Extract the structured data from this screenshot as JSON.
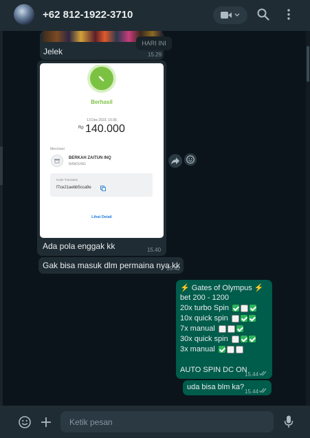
{
  "header": {
    "contact": "+62 812-1922-3710"
  },
  "chat": {
    "messages": {
      "m1": {
        "text": "Jelek",
        "time": "15.29"
      },
      "date_badge": "HARI INI",
      "receipt": {
        "status": "Berhasil",
        "date": "13 Des 2023, 15:36",
        "currency": "Rp",
        "amount": "140.000",
        "merchant_label": "Merchant",
        "merchant_name": "BERKAH ZAITUN INQ",
        "merchant_city": "BANDUNG",
        "trx_label": "Kode Transaksi",
        "trx_id": "f7ce21aebb5cca9e",
        "detail_link": "Lihat Detail"
      },
      "m2": {
        "text": "Ada pola enggak kk",
        "time": "15.40"
      },
      "m3": {
        "text": "Gak bisa masuk dlm permaina nya kk",
        "time": "15.42"
      },
      "m4": {
        "line1": "⚡ Gates of Olympus ⚡",
        "line2": "bet 200 - 1200",
        "line3": "20x turbo Spin",
        "line4": "10x quick spin",
        "line5": "7x manual",
        "line6": "30x quick spin",
        "line7": "3x manual",
        "line8": "AUTO SPIN DC ON",
        "time": "15.44"
      },
      "m5": {
        "text": "uda bisa blm ka?",
        "time": "15.44"
      }
    }
  },
  "composer": {
    "placeholder": "Ketik pesan"
  },
  "colors": {
    "header_bg": "#202c33",
    "chat_bg": "#0b141a",
    "incoming": "#202c33",
    "outgoing": "#005c4b",
    "success_green": "#7cc242",
    "check_green": "#2fb45a"
  }
}
